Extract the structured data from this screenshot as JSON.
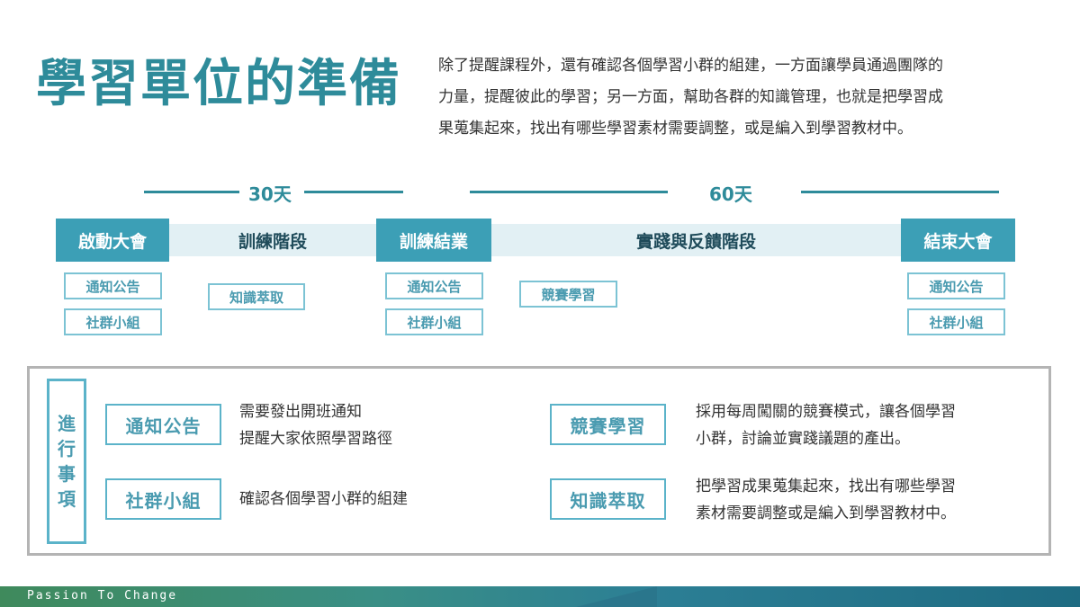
{
  "header": {
    "title": "學習單位的準備",
    "intro_lines": [
      "除了提醒課程外，還有確認各個學習小群的組建，一方面讓學員通過團隊的",
      "力量，提醒彼此的學習；另一方面，幫助各群的知識管理，也就是把學習成",
      "果蒐集起來，找出有哪些學習素材需要調整，或是編入到學習教材中。"
    ]
  },
  "timeline": {
    "span1": "30天",
    "span2": "60天",
    "stages": [
      "啟動大會",
      "訓練結業",
      "結束大會"
    ],
    "phases": [
      "訓練階段",
      "實踐與反饋階段"
    ],
    "chips": {
      "start_1": "通知公告",
      "start_2": "社群小組",
      "train": "知識萃取",
      "grad_1": "通知公告",
      "grad_2": "社群小組",
      "practice": "競賽學習",
      "end_1": "通知公告",
      "end_2": "社群小組"
    }
  },
  "tasks": {
    "label_chars": [
      "進",
      "行",
      "事",
      "項"
    ],
    "items": [
      {
        "key": "通知公告",
        "lines": [
          "需要發出開班通知",
          "提醒大家依照學習路徑"
        ]
      },
      {
        "key": "社群小組",
        "lines": [
          "確認各個學習小群的組建"
        ]
      },
      {
        "key": "競賽學習",
        "lines": [
          "採用每周闖關的競賽模式，讓各個學習",
          "小群，討論並實踐議題的產出。"
        ]
      },
      {
        "key": "知識萃取",
        "lines": [
          "把學習成果蒐集起來，找出有哪些學習",
          "素材需要調整或是編入到學習教材中。"
        ]
      }
    ]
  },
  "footer": {
    "tagline": "Passion To Change"
  },
  "colors": {
    "accent": "#2e8b9a",
    "stage_bg": "#3c9fb6",
    "band_bg": "#e2f0f4",
    "chip_border": "#7cc3d4"
  }
}
